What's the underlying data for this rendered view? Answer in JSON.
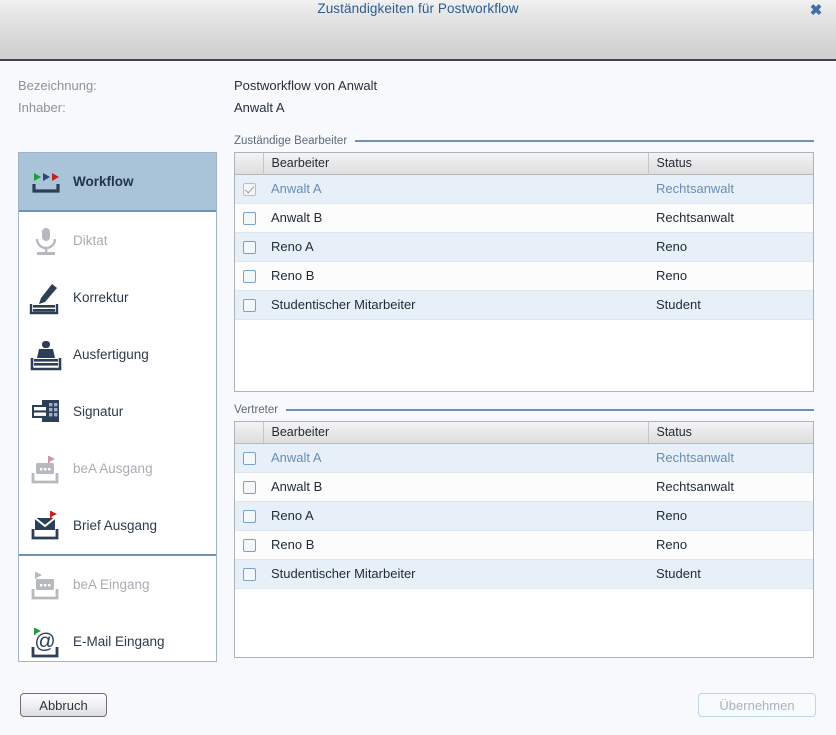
{
  "window": {
    "title": "Zuständigkeiten für Postworkflow",
    "close_icon": "close-icon",
    "close_glyph": "✖"
  },
  "meta": {
    "label_name": "Bezeichnung:",
    "value_name": "Postworkflow von Anwalt",
    "label_owner": "Inhaber:",
    "value_owner": "Anwalt A"
  },
  "sidebar": {
    "groups": [
      {
        "items": [
          {
            "label": "Workflow",
            "icon": "workflow-arrows-icon",
            "selected": true,
            "disabled": false
          }
        ]
      },
      {
        "items": [
          {
            "label": "Diktat",
            "icon": "microphone-icon",
            "selected": false,
            "disabled": true
          },
          {
            "label": "Korrektur",
            "icon": "pencil-edit-icon",
            "selected": false,
            "disabled": false
          },
          {
            "label": "Ausfertigung",
            "icon": "stamp-icon",
            "selected": false,
            "disabled": false
          },
          {
            "label": "Signatur",
            "icon": "signature-card-icon",
            "selected": false,
            "disabled": false
          },
          {
            "label": "beA Ausgang",
            "icon": "bea-outbox-icon",
            "selected": false,
            "disabled": true
          },
          {
            "label": "Brief Ausgang",
            "icon": "envelope-outbox-icon",
            "selected": false,
            "disabled": false
          }
        ]
      },
      {
        "items": [
          {
            "label": "beA Eingang",
            "icon": "bea-inbox-icon",
            "selected": false,
            "disabled": true
          },
          {
            "label": "E-Mail Eingang",
            "icon": "at-inbox-icon",
            "selected": false,
            "disabled": false
          }
        ]
      }
    ]
  },
  "tables": [
    {
      "caption": "Zuständige Bearbeiter",
      "columns": {
        "checkbox": "",
        "name": "Bearbeiter",
        "status": "Status"
      },
      "rows": [
        {
          "checked": true,
          "checkbox_disabled": true,
          "name": "Anwalt A",
          "status": "Rechtsanwalt",
          "muted": true
        },
        {
          "checked": false,
          "checkbox_disabled": false,
          "name": "Anwalt B",
          "status": "Rechtsanwalt",
          "muted": false
        },
        {
          "checked": false,
          "checkbox_disabled": false,
          "name": "Reno A",
          "status": "Reno",
          "muted": false
        },
        {
          "checked": false,
          "checkbox_disabled": false,
          "name": "Reno B",
          "status": "Reno",
          "muted": false
        },
        {
          "checked": false,
          "checkbox_disabled": false,
          "name": "Studentischer Mitarbeiter",
          "status": "Student",
          "muted": false
        }
      ]
    },
    {
      "caption": "Vertreter",
      "columns": {
        "checkbox": "",
        "name": "Bearbeiter",
        "status": "Status"
      },
      "rows": [
        {
          "checked": false,
          "checkbox_disabled": false,
          "name": "Anwalt A",
          "status": "Rechtsanwalt",
          "muted": true
        },
        {
          "checked": false,
          "checkbox_disabled": false,
          "name": "Anwalt B",
          "status": "Rechtsanwalt",
          "muted": false
        },
        {
          "checked": false,
          "checkbox_disabled": false,
          "name": "Reno A",
          "status": "Reno",
          "muted": false
        },
        {
          "checked": false,
          "checkbox_disabled": false,
          "name": "Reno B",
          "status": "Reno",
          "muted": false
        },
        {
          "checked": false,
          "checkbox_disabled": false,
          "name": "Studentischer Mitarbeiter",
          "status": "Student",
          "muted": false
        }
      ]
    }
  ],
  "footer": {
    "cancel_label": "Abbruch",
    "apply_label": "Übernehmen",
    "apply_enabled": false
  },
  "colors": {
    "accent_blue": "#2e5c8f",
    "selected_row": "#a9c3d9",
    "alt_row": "#e7f0f8",
    "rule": "#6f93b5",
    "muted_text": "#6b8db0"
  }
}
